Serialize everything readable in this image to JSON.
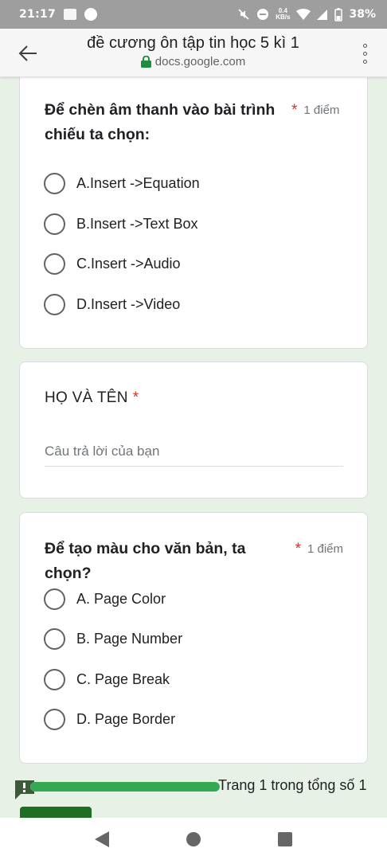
{
  "status_bar": {
    "time": "21:17",
    "net_speed_top": "0.4",
    "net_speed_bottom": "KB/s",
    "battery": "38%"
  },
  "browser": {
    "title": "đề cương ôn tập tin học 5 kì 1",
    "url": "docs.google.com"
  },
  "questions": [
    {
      "text": "Để chèn âm thanh vào bài trình chiếu ta chọn:",
      "required": "*",
      "points": "1 điểm",
      "options": [
        "A.Insert ->Equation",
        "B.Insert ->Text Box",
        "C.Insert ->Audio",
        "D.Insert ->Video"
      ]
    },
    {
      "text": "Để tạo màu cho văn bản, ta chọn?",
      "required": "*",
      "points": "1 điểm",
      "options": [
        "A. Page Color",
        "B. Page Number",
        "C. Page Break",
        "D. Page Border"
      ]
    }
  ],
  "name_field": {
    "label": "HỌ VÀ TÊN",
    "required": "*",
    "placeholder": "Câu trả lời của bạn"
  },
  "progress": {
    "text": "Trang 1 trong tổng số 1",
    "fraction": 1.0
  },
  "colors": {
    "accent": "#34a853",
    "required": "#d93025",
    "background": "#e8f1e6"
  }
}
